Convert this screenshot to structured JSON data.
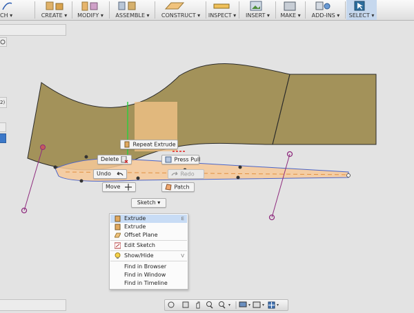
{
  "toolbar": {
    "groups": [
      {
        "label": "CH ▾"
      },
      {
        "label": "CREATE ▾"
      },
      {
        "label": "MODIFY ▾"
      },
      {
        "label": "ASSEMBLE ▾"
      },
      {
        "label": "CONSTRUCT ▾"
      },
      {
        "label": "INSPECT ▾"
      },
      {
        "label": "INSERT ▾"
      },
      {
        "label": "MAKE ▾"
      },
      {
        "label": "ADD-INS ▾"
      },
      {
        "label": "SELECT ▾"
      }
    ]
  },
  "left_panel": {
    "count_label": "2)"
  },
  "marking_menu": {
    "repeat": "Repeat Extrude",
    "delete": "Delete",
    "press_pull": "Press Pull",
    "undo": "Undo",
    "redo": "Redo",
    "move": "Move",
    "patch": "Patch",
    "sketch": "Sketch ▾"
  },
  "overflow_menu": {
    "items": [
      {
        "label": "Extrude",
        "shortcut": "E",
        "icon": "extrude-icon"
      },
      {
        "label": "Extrude",
        "icon": "extrude-icon"
      },
      {
        "label": "Offset Plane",
        "icon": "offset-plane-icon"
      },
      {
        "label": "Edit Sketch",
        "icon": "edit-sketch-icon"
      },
      {
        "label": "Show/Hide",
        "shortcut": "V",
        "icon": "lightbulb-icon"
      },
      {
        "label": "Find in Browser"
      },
      {
        "label": "Find in Window"
      },
      {
        "label": "Find in Timeline"
      }
    ]
  },
  "colors": {
    "surface": "#a3925a",
    "selected_face": "#f5c48a",
    "profile_line": "#4a64c8",
    "spline": "#8e2b7e",
    "menu_highlight": "#c8dcf5"
  }
}
